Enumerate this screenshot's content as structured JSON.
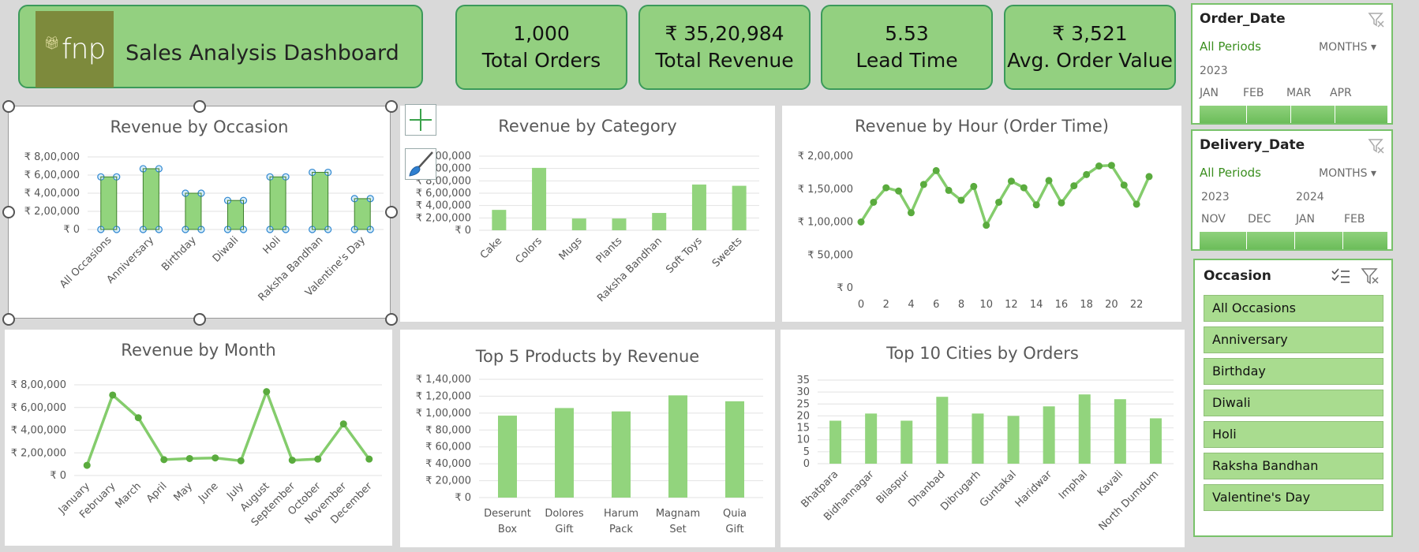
{
  "header": {
    "logo_text": "fnp",
    "title": "Sales Analysis Dashboard"
  },
  "kpis": [
    {
      "value": "1,000",
      "label": "Total Orders"
    },
    {
      "value": "₹ 35,20,984",
      "label": "Total Revenue"
    },
    {
      "value": "5.53",
      "label": "Lead Time"
    },
    {
      "value": "₹ 3,521",
      "label": "Avg. Order Value"
    }
  ],
  "colors": {
    "bar": "#92d47d",
    "line": "#84cc6c",
    "marker": "#5aab3e",
    "accent_border": "#3b9a5a"
  },
  "slicers": {
    "order_date": {
      "title": "Order_Date",
      "period": "All Periods",
      "unit": "MONTHS",
      "years": [
        "2023"
      ],
      "months": [
        "JAN",
        "FEB",
        "MAR",
        "APR"
      ]
    },
    "delivery_date": {
      "title": "Delivery_Date",
      "period": "All Periods",
      "unit": "MONTHS",
      "years": [
        "2023",
        "2024"
      ],
      "months": [
        "NOV",
        "DEC",
        "JAN",
        "FEB"
      ]
    },
    "occasion": {
      "title": "Occasion",
      "items": [
        "All Occasions",
        "Anniversary",
        "Birthday",
        "Diwali",
        "Holi",
        "Raksha Bandhan",
        "Valentine's Day"
      ]
    }
  },
  "chart_data": [
    {
      "id": "occasion",
      "type": "bar",
      "title": "Revenue by Occasion",
      "categories": [
        "All Occasions",
        "Anniversary",
        "Birthday",
        "Diwali",
        "Holi",
        "Raksha Bandhan",
        "Valentine's Day"
      ],
      "values": [
        580000,
        670000,
        400000,
        320000,
        580000,
        630000,
        340000
      ],
      "yticks": [
        "₹ 0",
        "₹ 2,00,000",
        "₹ 4,00,000",
        "₹ 6,00,000",
        "₹ 8,00,000"
      ],
      "ylim": [
        0,
        800000
      ],
      "grid": true
    },
    {
      "id": "category",
      "type": "bar",
      "title": "Revenue by Category",
      "categories": [
        "Cake",
        "Colors",
        "Mugs",
        "Plants",
        "Raksha Bandhan",
        "Soft Toys",
        "Sweets"
      ],
      "values": [
        330000,
        1010000,
        190000,
        190000,
        280000,
        740000,
        720000
      ],
      "yticks": [
        "₹ 0",
        "₹ 2,00,000",
        "₹ 4,00,000",
        "₹ 6,00,000",
        "₹ 8,00,000",
        "₹ 10,00,000",
        "₹ 12,00,000"
      ],
      "ylim": [
        0,
        1200000
      ],
      "grid": true
    },
    {
      "id": "hour",
      "type": "line",
      "title": "Revenue by Hour (Order Time)",
      "x": [
        0,
        1,
        2,
        3,
        4,
        5,
        6,
        7,
        8,
        9,
        10,
        11,
        12,
        13,
        14,
        15,
        16,
        17,
        18,
        19,
        20,
        21,
        22,
        23
      ],
      "values": [
        100000,
        130000,
        152000,
        147000,
        114000,
        157000,
        178000,
        148000,
        133000,
        154000,
        95000,
        130000,
        162000,
        152000,
        126000,
        163000,
        129000,
        155000,
        172000,
        185000,
        186000,
        156000,
        127000,
        169000
      ],
      "xticks": [
        "0",
        "2",
        "4",
        "6",
        "8",
        "10",
        "12",
        "14",
        "16",
        "18",
        "20",
        "22"
      ],
      "yticks": [
        "₹ 0",
        "₹ 50,000",
        "₹ 1,00,000",
        "₹ 1,50,000",
        "₹ 2,00,000"
      ],
      "ylim": [
        0,
        200000
      ],
      "grid": false
    },
    {
      "id": "month",
      "type": "line",
      "title": "Revenue by Month",
      "categories": [
        "January",
        "February",
        "March",
        "April",
        "May",
        "June",
        "July",
        "August",
        "September",
        "October",
        "November",
        "December"
      ],
      "values": [
        90000,
        710000,
        510000,
        140000,
        150000,
        155000,
        130000,
        740000,
        135000,
        145000,
        455000,
        145000
      ],
      "yticks": [
        "₹ 0",
        "₹ 2,00,000",
        "₹ 4,00,000",
        "₹ 6,00,000",
        "₹ 8,00,000"
      ],
      "ylim": [
        0,
        800000
      ],
      "grid": true
    },
    {
      "id": "products",
      "type": "bar",
      "title": "Top 5 Products by Revenue",
      "categories": [
        "Deserunt Box",
        "Dolores Gift",
        "Harum Pack",
        "Magnam Set",
        "Quia Gift"
      ],
      "values": [
        97000,
        106000,
        102000,
        121000,
        114000
      ],
      "yticks": [
        "₹ 0",
        "₹ 20,000",
        "₹ 40,000",
        "₹ 60,000",
        "₹ 80,000",
        "₹ 1,00,000",
        "₹ 1,20,000",
        "₹ 1,40,000"
      ],
      "ylim": [
        0,
        140000
      ],
      "grid": true
    },
    {
      "id": "cities",
      "type": "bar",
      "title": "Top 10 Cities by Orders",
      "categories": [
        "Bhatpara",
        "Bidhannagar",
        "Bilaspur",
        "Dhanbad",
        "Dibrugarh",
        "Guntakal",
        "Haridwar",
        "Imphal",
        "Kavali",
        "North Dumdum"
      ],
      "values": [
        18,
        21,
        18,
        28,
        21,
        20,
        24,
        29,
        27,
        19
      ],
      "yticks": [
        "0",
        "5",
        "10",
        "15",
        "20",
        "25",
        "30",
        "35"
      ],
      "ylim": [
        0,
        35
      ],
      "grid": true
    }
  ]
}
